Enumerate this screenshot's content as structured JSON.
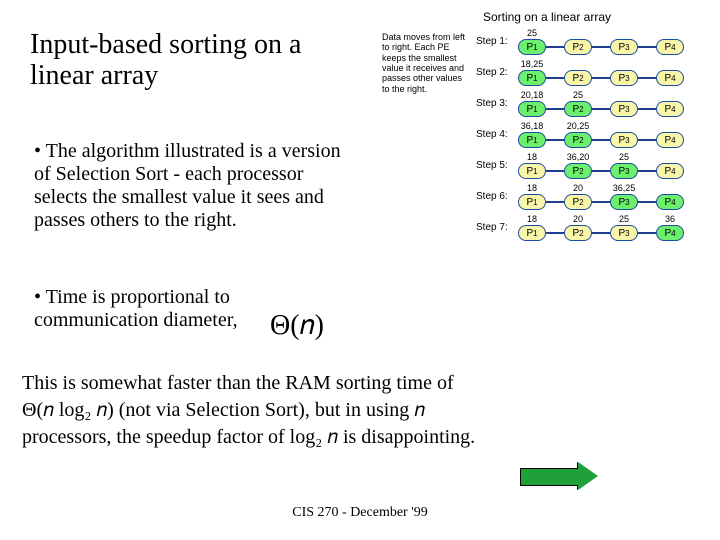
{
  "title": "Input-based sorting on a linear array",
  "bullet1": "• The algorithm illustrated is a version of Selection Sort - each processor selects the smallest value it sees and passes others to the right.",
  "bullet2": "• Time is proportional to communication diameter,",
  "theta_inline": "Θ(𝑛)",
  "note_line1": "This is somewhat faster than the RAM sorting time of",
  "note_line2_a": "Θ(𝑛 log₂ 𝑛) (not via Selection Sort), but in using 𝑛",
  "note_line3": "processors, the speedup factor of log₂ 𝑛 is disappointing.",
  "footer": "CIS 270 - December '99",
  "diagram": {
    "title": "Sorting on a linear array",
    "caption": "Data moves from left to right. Each PE keeps the smallest value it receives and passes other values to the right.",
    "procs": [
      "P₁",
      "P₂",
      "P₃",
      "P₄"
    ],
    "steps": [
      {
        "label": "Step 1:",
        "above": [
          "25",
          "",
          "",
          ""
        ],
        "green": [
          0
        ]
      },
      {
        "label": "Step 2:",
        "above": [
          "18,25",
          "",
          "",
          ""
        ],
        "green": [
          0
        ]
      },
      {
        "label": "Step 3:",
        "above": [
          "20,18",
          "25",
          "",
          ""
        ],
        "green": [
          0,
          1
        ]
      },
      {
        "label": "Step 4:",
        "above": [
          "36,18",
          "20,25",
          "",
          ""
        ],
        "green": [
          0,
          1
        ]
      },
      {
        "label": "Step 5:",
        "above": [
          "18",
          "36,20",
          "25",
          ""
        ],
        "green": [
          1,
          2
        ]
      },
      {
        "label": "Step 6:",
        "above": [
          "18",
          "20",
          "36,25",
          ""
        ],
        "green": [
          2,
          3
        ]
      },
      {
        "label": "Step 7:",
        "above": [
          "18",
          "20",
          "25",
          "36"
        ],
        "green": [
          3
        ]
      }
    ]
  }
}
